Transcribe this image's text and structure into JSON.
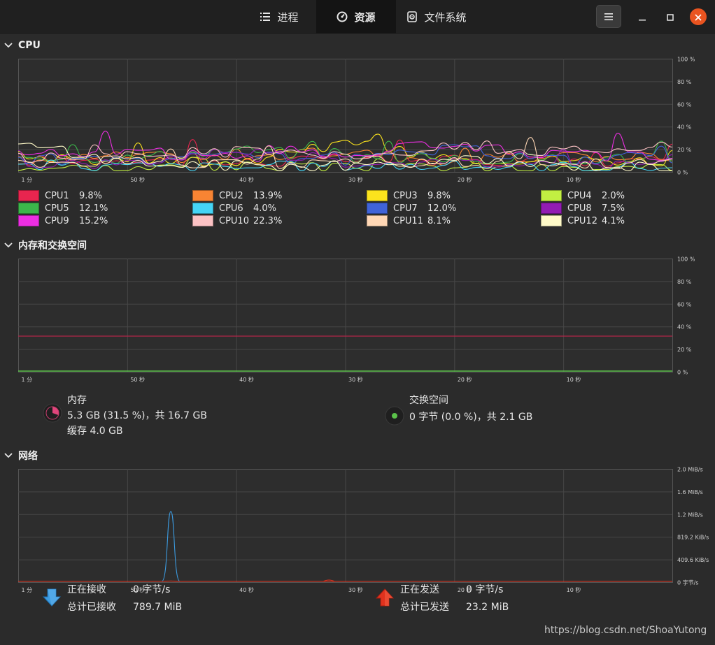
{
  "header": {
    "tabs": [
      {
        "label": "进程",
        "icon": "list-icon",
        "active": false
      },
      {
        "label": "资源",
        "icon": "gauge-icon",
        "active": true
      },
      {
        "label": "文件系统",
        "icon": "disk-icon",
        "active": false
      }
    ]
  },
  "cpu": {
    "title": "CPU",
    "y_ticks": [
      "100 %",
      "80 %",
      "60 %",
      "40 %",
      "20 %",
      "0 %"
    ],
    "x_ticks": [
      "1 分",
      "50 秒",
      "40 秒",
      "30 秒",
      "20 秒",
      "10 秒"
    ],
    "legend": [
      {
        "name": "CPU1",
        "value": "9.8%",
        "color": "#e8254f"
      },
      {
        "name": "CPU2",
        "value": "13.9%",
        "color": "#f88433"
      },
      {
        "name": "CPU3",
        "value": "9.8%",
        "color": "#fbe31d"
      },
      {
        "name": "CPU4",
        "value": "2.0%",
        "color": "#c2ef42"
      },
      {
        "name": "CPU5",
        "value": "12.1%",
        "color": "#3cb64b"
      },
      {
        "name": "CPU6",
        "value": "4.0%",
        "color": "#45d4f5"
      },
      {
        "name": "CPU7",
        "value": "12.0%",
        "color": "#4063d8"
      },
      {
        "name": "CPU8",
        "value": "7.5%",
        "color": "#921cb3"
      },
      {
        "name": "CPU9",
        "value": "15.2%",
        "color": "#ec2ee2"
      },
      {
        "name": "CPU10",
        "value": "22.3%",
        "color": "#fcc2c4"
      },
      {
        "name": "CPU11",
        "value": "8.1%",
        "color": "#ffd7b5"
      },
      {
        "name": "CPU12",
        "value": "4.1%",
        "color": "#fffac8"
      }
    ]
  },
  "memory": {
    "title": "内存和交换空间",
    "y_ticks": [
      "100 %",
      "80 %",
      "60 %",
      "40 %",
      "20 %",
      "0 %"
    ],
    "x_ticks": [
      "1 分",
      "50 秒",
      "40 秒",
      "30 秒",
      "20 秒",
      "10 秒"
    ],
    "mem_label": "内存",
    "mem_value": "5.3 GB (31.5 %)，共 16.7 GB",
    "cache_value": "缓存 4.0 GB",
    "mem_color": "#b3254a",
    "swap_label": "交换空间",
    "swap_value": "0 字节 (0.0 %)，共 2.1 GB",
    "swap_color": "#5bc24a"
  },
  "network": {
    "title": "网络",
    "y_ticks": [
      "2.0 MiB/s",
      "1.6 MiB/s",
      "1.2 MiB/s",
      "819.2 KiB/s",
      "409.6 KiB/s",
      "0 字节/s"
    ],
    "x_ticks": [
      "1 分",
      "50 秒",
      "40 秒",
      "30 秒",
      "20 秒",
      "10 秒"
    ],
    "recv_label": "正在接收",
    "recv_value": "0 字节/s",
    "recv_total_label": "总计已接收",
    "recv_total_value": "789.7 MiB",
    "send_label": "正在发送",
    "send_value": "0 字节/s",
    "send_total_label": "总计已发送",
    "send_total_value": "23.2 MiB",
    "recv_color": "#3c9be0",
    "send_color": "#e0321e"
  },
  "chart_data": [
    {
      "type": "line",
      "title": "CPU",
      "x": [
        60,
        50,
        40,
        30,
        20,
        10,
        0
      ],
      "ylim": [
        0,
        100
      ],
      "series": [
        {
          "name": "CPU1",
          "values": [
            10,
            12,
            8,
            11,
            10,
            9,
            9.8
          ]
        },
        {
          "name": "CPU2",
          "values": [
            9,
            14,
            12,
            18,
            10,
            13,
            13.9
          ]
        },
        {
          "name": "CPU3",
          "values": [
            14,
            10,
            9,
            25,
            12,
            11,
            9.8
          ]
        },
        {
          "name": "CPU4",
          "values": [
            4,
            3,
            5,
            3,
            4,
            2,
            2.0
          ]
        },
        {
          "name": "CPU5",
          "values": [
            15,
            12,
            20,
            13,
            11,
            12,
            12.1
          ]
        },
        {
          "name": "CPU6",
          "values": [
            6,
            5,
            4,
            6,
            5,
            5,
            4.0
          ]
        },
        {
          "name": "CPU7",
          "values": [
            12,
            9,
            14,
            10,
            20,
            11,
            12.0
          ]
        },
        {
          "name": "CPU8",
          "values": [
            8,
            7,
            20,
            9,
            8,
            7,
            7.5
          ]
        },
        {
          "name": "CPU9",
          "values": [
            14,
            18,
            12,
            16,
            25,
            14,
            15.2
          ]
        },
        {
          "name": "CPU10",
          "values": [
            12,
            15,
            18,
            14,
            22,
            18,
            22.3
          ]
        },
        {
          "name": "CPU11",
          "values": [
            8,
            10,
            6,
            9,
            8,
            7,
            8.1
          ]
        },
        {
          "name": "CPU12",
          "values": [
            25,
            8,
            6,
            5,
            10,
            6,
            4.1
          ]
        }
      ]
    },
    {
      "type": "line",
      "title": "内存和交换空间",
      "x": [
        60,
        0
      ],
      "ylim": [
        0,
        100
      ],
      "series": [
        {
          "name": "内存",
          "values": [
            31.5,
            31.5
          ]
        },
        {
          "name": "交换空间",
          "values": [
            0,
            0
          ]
        }
      ]
    },
    {
      "type": "line",
      "title": "网络",
      "ylim_mib": [
        0,
        2.0
      ],
      "series": [
        {
          "name": "正在接收",
          "peak_mib_s": 1.25,
          "peak_at_s": 46
        },
        {
          "name": "正在发送",
          "peak_mib_s": 0.02,
          "peak_at_s": 46
        }
      ]
    }
  ],
  "watermark": "https://blog.csdn.net/ShoaYutong"
}
